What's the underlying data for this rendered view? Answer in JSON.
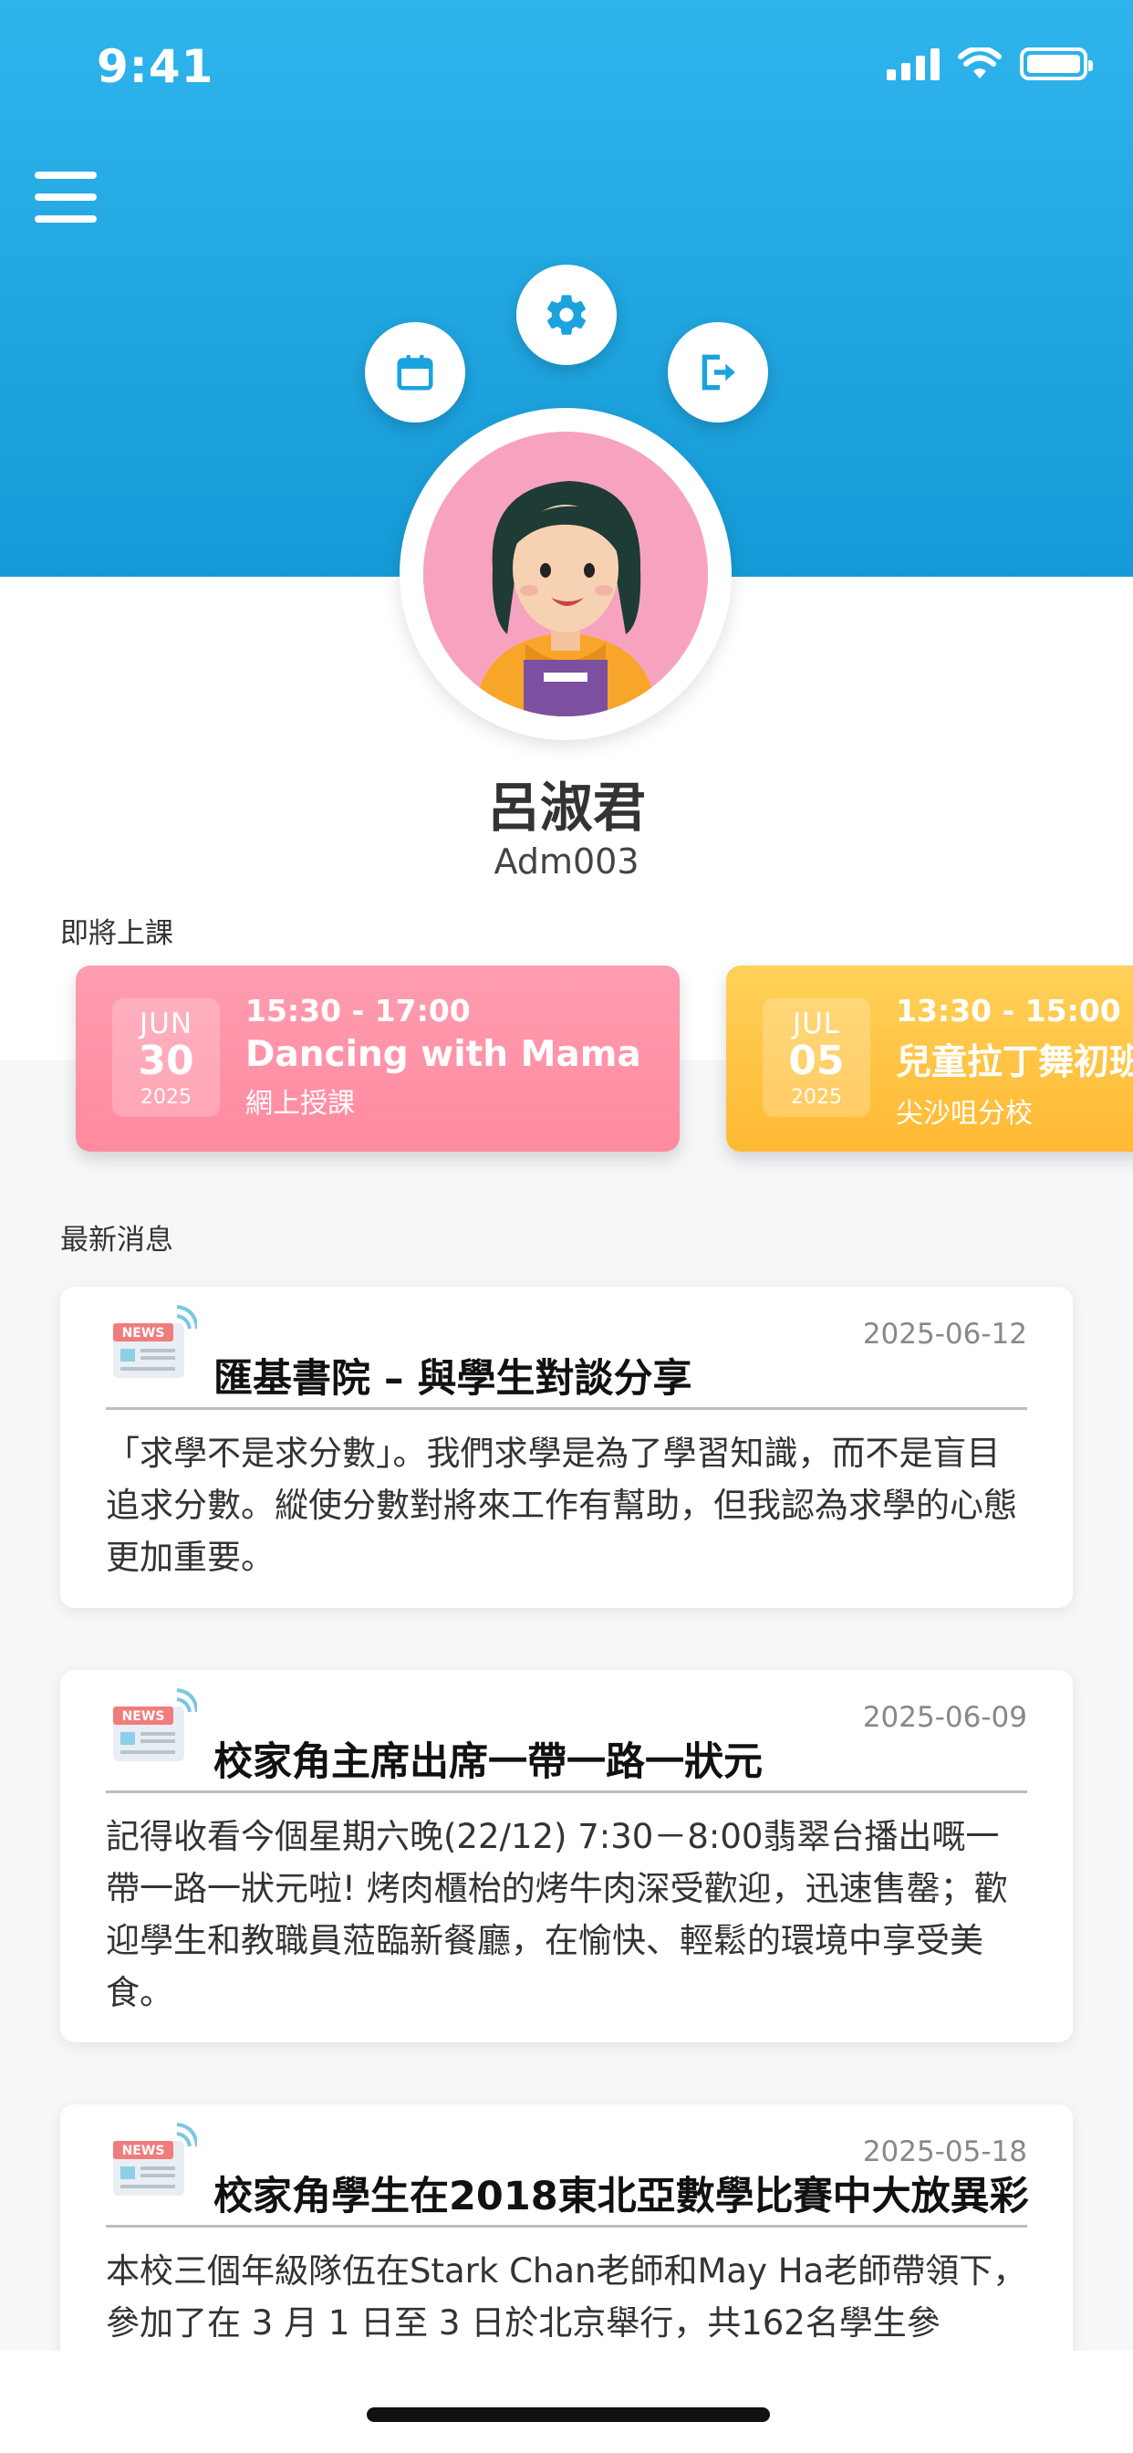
{
  "status_bar": {
    "time": "9:41"
  },
  "header": {
    "menu_icon": "hamburger-menu-icon",
    "actions": [
      {
        "name": "calendar",
        "icon": "calendar-icon"
      },
      {
        "name": "settings",
        "icon": "gear-icon"
      },
      {
        "name": "logout",
        "icon": "logout-icon"
      }
    ],
    "accent_color": "#1aa3dd"
  },
  "profile": {
    "name": "呂淑君",
    "id": "Adm003"
  },
  "upcoming": {
    "label": "即將上課",
    "classes": [
      {
        "month": "JUN",
        "day": "30",
        "year": "2025",
        "time": "15:30 - 17:00",
        "title": "Dancing with Mama",
        "location": "網上授課",
        "color": "#ff8fa3"
      },
      {
        "month": "JUL",
        "day": "05",
        "year": "2025",
        "time": "13:30 - 15:00",
        "title": "兒童拉丁舞初班",
        "location": "尖沙咀分校",
        "color": "#ffc040"
      }
    ]
  },
  "news": {
    "label": "最新消息",
    "items": [
      {
        "date": "2025-06-12",
        "title": "匯基書院 – 與學生對談分享",
        "body": "「求學不是求分數」。我們求學是為了學習知識，而不是盲目追求分數。縱使分數對將來工作有幫助，但我認為求學的心態更加重要。"
      },
      {
        "date": "2025-06-09",
        "title": "校家角主席出席一帶一路一狀元",
        "body": "記得收看今個星期六晚(22/12) 7:30－8:00翡翠台播出嘅一帶一路一狀元啦! 烤肉櫃枱的烤牛肉深受歡迎，迅速售罄；歡迎學生和教職員蒞臨新餐廳，在愉快、輕鬆的環境中享受美食。"
      },
      {
        "date": "2025-05-18",
        "title": "校家角學生在2018東北亞數學比賽中大放異彩",
        "body": "本校三個年級隊伍在Stark Chan老師和May Ha老師帶領下，參加了在 3 月 1 日至 3 日於北京舉行，共162名學生參"
      }
    ]
  }
}
